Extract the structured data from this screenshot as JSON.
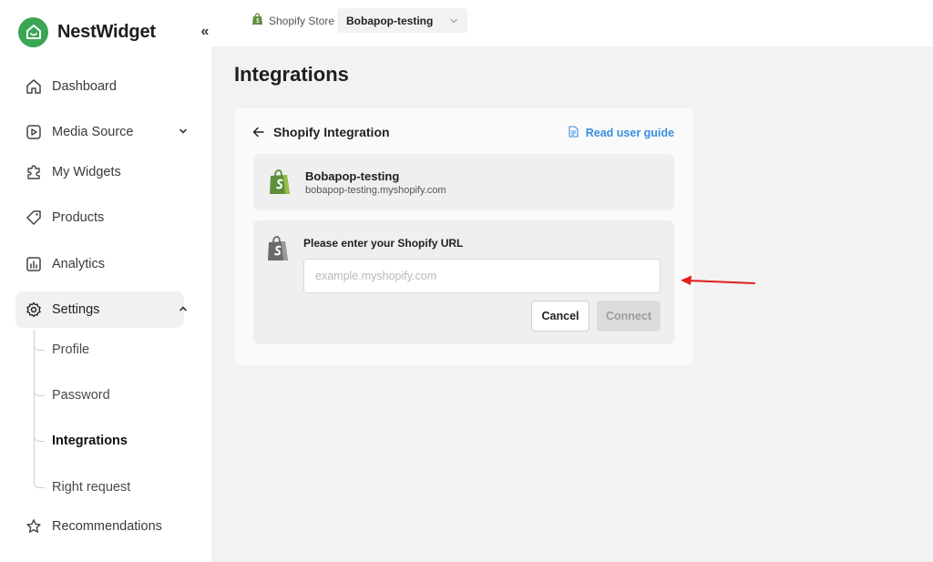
{
  "app": {
    "name": "NestWidget",
    "collapse_glyph": "«"
  },
  "colors": {
    "brand_green": "#3aa655",
    "link_blue": "#3b8ee0",
    "annotation_red": "#e11d1d"
  },
  "sidebar": {
    "items": [
      {
        "label": "Dashboard",
        "icon": "home-icon"
      },
      {
        "label": "Media Source",
        "icon": "play-square-icon",
        "expanded": false
      },
      {
        "label": "My Widgets",
        "icon": "puzzle-icon"
      },
      {
        "label": "Products",
        "icon": "tag-icon"
      },
      {
        "label": "Analytics",
        "icon": "chart-icon"
      },
      {
        "label": "Settings",
        "icon": "gear-icon",
        "expanded": true,
        "active": true
      },
      {
        "label": "Recommendations",
        "icon": "star-icon"
      }
    ],
    "settings_sub": [
      {
        "label": "Profile"
      },
      {
        "label": "Password"
      },
      {
        "label": "Integrations",
        "active": true
      },
      {
        "label": "Right request"
      }
    ]
  },
  "topbar": {
    "store_label": "Shopify Store",
    "store_selected": "Bobapop-testing"
  },
  "page": {
    "title": "Integrations"
  },
  "integration": {
    "header": "Shopify Integration",
    "guide_link": "Read user guide",
    "store": {
      "name": "Bobapop-testing",
      "domain": "bobapop-testing.myshopify.com"
    },
    "form": {
      "label": "Please enter your Shopify URL",
      "input_value": "",
      "input_placeholder": "example.myshopify.com",
      "cancel_label": "Cancel",
      "connect_label": "Connect",
      "connect_disabled": true
    }
  }
}
